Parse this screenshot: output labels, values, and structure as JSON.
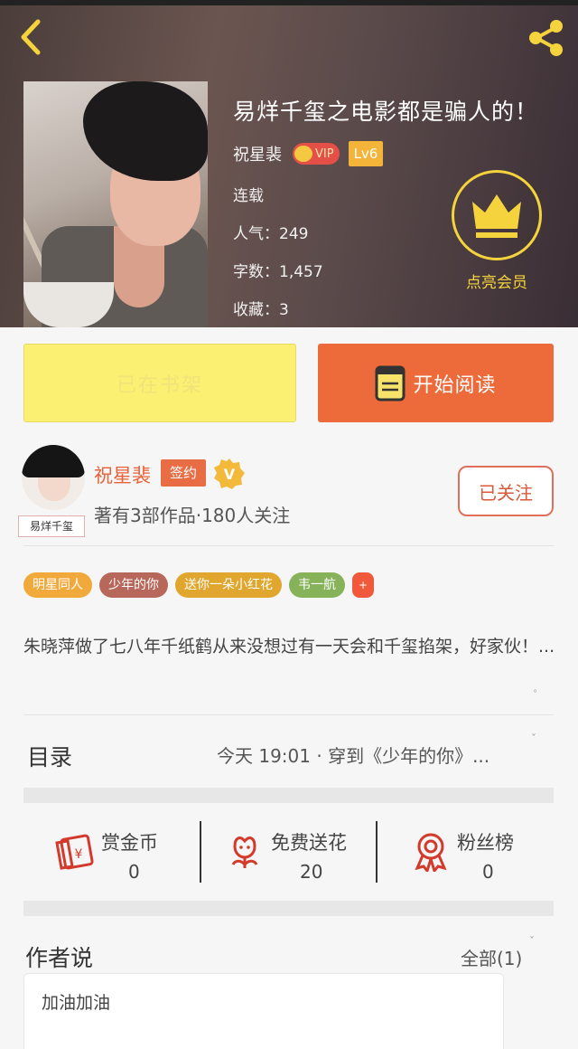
{
  "header": {
    "title": "易烊千玺之电影都是骗人的！",
    "author": "祝星裴",
    "vip_label": "VIP",
    "level_label": "Lv6",
    "status": "连载",
    "popularity": "人气：249",
    "word_count": "字数：1,457",
    "favorites": "收藏：3",
    "member_label": "点亮会员"
  },
  "actions": {
    "shelf_label": "已在书架",
    "read_label": "开始阅读"
  },
  "author": {
    "name": "祝星裴",
    "sign_label": "签约",
    "avatar_tag": "易烊千玺",
    "stats": "著有3部作品·180人关注",
    "follow_label": "已关注"
  },
  "tags": [
    {
      "label": "明星同人",
      "color": "#f2a93b"
    },
    {
      "label": "少年的你",
      "color": "#b8685a"
    },
    {
      "label": "送你一朵小红花",
      "color": "#e0a62e"
    },
    {
      "label": "韦一航",
      "color": "#86b25a"
    }
  ],
  "tag_more": "+",
  "summary": "朱晓萍做了七八年千纸鹤从来没想过有一天会和千玺掐架，好家伙！...",
  "toc": {
    "label": "目录",
    "latest": "今天 19:01 · 穿到《少年的你》..."
  },
  "stats": {
    "reward": {
      "label": "赏金币",
      "value": "0"
    },
    "flowers": {
      "label": "免费送花",
      "value": "20"
    },
    "fans": {
      "label": "粉丝榜",
      "value": "0"
    }
  },
  "author_says": {
    "label": "作者说",
    "all_label": "全部(1)",
    "comment": "加油加油"
  },
  "colors": {
    "accent_orange": "#ed6a3a",
    "shelf_yellow": "#fbf071",
    "member_gold": "#f5d33c"
  }
}
